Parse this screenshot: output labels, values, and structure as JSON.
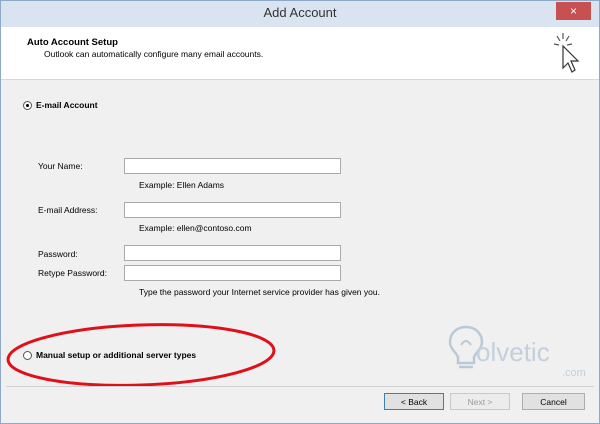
{
  "window": {
    "title": "Add Account",
    "close_glyph": "×"
  },
  "header": {
    "title": "Auto Account Setup",
    "subtitle": "Outlook can automatically configure many email accounts.",
    "icon": "cursor-sparkle-icon"
  },
  "email_account": {
    "radio_label": "E-mail Account",
    "selected": true,
    "name_label": "Your Name:",
    "name_value": "",
    "name_hint": "Example: Ellen Adams",
    "email_label": "E-mail Address:",
    "email_value": "",
    "email_hint": "Example: ellen@contoso.com",
    "password_label": "Password:",
    "password_value": "",
    "retype_label": "Retype Password:",
    "retype_value": "",
    "password_hint": "Type the password your Internet service provider has given you."
  },
  "manual": {
    "radio_label": "Manual setup or additional server types",
    "selected": false
  },
  "watermark": {
    "text": "olvetic",
    "suffix": ".com"
  },
  "footer": {
    "back_label": "< Back",
    "next_label": "Next >",
    "cancel_label": "Cancel"
  },
  "colors": {
    "highlight_ellipse": "#e0101a",
    "close_button": "#c75050",
    "titlebar": "#d9e4f0"
  }
}
